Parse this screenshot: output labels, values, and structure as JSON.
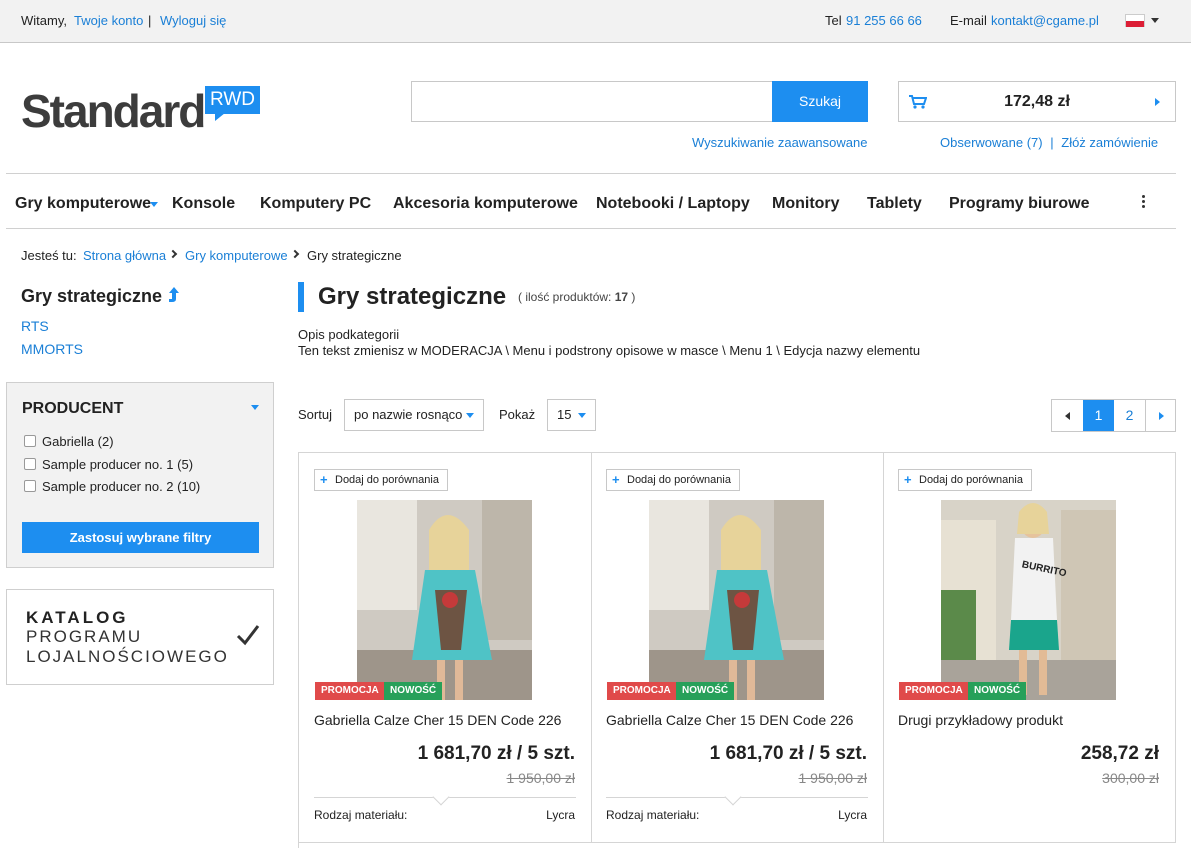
{
  "topbar": {
    "welcome": "Witamy,",
    "account_link": "Twoje konto",
    "separator": "|",
    "logout_link": "Wyloguj się",
    "phone_label": "Tel",
    "phone": "91 255 66 66",
    "email_label": "E-mail",
    "email": "kontakt@cgame.pl"
  },
  "header": {
    "logo": "Standard",
    "logo_badge": "RWD",
    "search_placeholder": "",
    "search_button": "Szukaj",
    "advanced_search": "Wyszukiwanie zaawansowane",
    "cart_total": "172,48 zł",
    "watched": "Obserwowane (7)",
    "separator": "|",
    "place_order": "Złóż zamówienie"
  },
  "nav": {
    "items": [
      "Gry komputerowe",
      "Konsole",
      "Komputery PC",
      "Akcesoria komputerowe",
      "Notebooki / Laptopy",
      "Monitory",
      "Tablety",
      "Programy biurowe"
    ]
  },
  "breadcrumb": {
    "label": "Jesteś tu:",
    "items": [
      "Strona główna",
      "Gry komputerowe",
      "Gry strategiczne"
    ]
  },
  "sidebar": {
    "title": "Gry strategiczne",
    "links": [
      "RTS",
      "MMORTS"
    ],
    "filter": {
      "title": "PRODUCENT",
      "options": [
        "Gabriella (2)",
        "Sample producer no. 1 (5)",
        "Sample producer no. 2 (10)"
      ],
      "apply": "Zastosuj wybrane filtry"
    },
    "loyalty": {
      "line1": "KATALOG",
      "line2": "PROGRAMU",
      "line3": "LOJALNOŚCIOWEGO"
    }
  },
  "main": {
    "title": "Gry strategiczne",
    "count_prefix": "( ilość produktów:",
    "count": "17",
    "count_suffix": ")",
    "desc_title": "Opis podkategorii",
    "desc_text": "Ten tekst zmienisz w MODERACJA \\ Menu i podstrony opisowe w masce \\ Menu 1 \\ Edycja nazwy elementu",
    "sort_label": "Sortuj",
    "sort_value": "po nazwie rosnąco",
    "show_label": "Pokaż",
    "show_value": "15",
    "pages": [
      "1",
      "2"
    ],
    "current_page": "1"
  },
  "products": [
    {
      "compare": "Dodaj do porównania",
      "badges": [
        "PROMOCJA",
        "NOWOŚĆ"
      ],
      "name": "Gabriella Calze Cher 15 DEN Code 226",
      "price": "1 681,70 zł / 5 szt.",
      "old_price": "1 950,00 zł",
      "attr_label": "Rodzaj materiału:",
      "attr_value": "Lycra"
    },
    {
      "compare": "Dodaj do porównania",
      "badges": [
        "PROMOCJA",
        "NOWOŚĆ"
      ],
      "name": "Gabriella Calze Cher 15 DEN Code 226",
      "price": "1 681,70 zł / 5 szt.",
      "old_price": "1 950,00 zł",
      "attr_label": "Rodzaj materiału:",
      "attr_value": "Lycra"
    },
    {
      "compare": "Dodaj do porównania",
      "badges": [
        "PROMOCJA",
        "NOWOŚĆ"
      ],
      "name": "Drugi przykładowy produkt",
      "price": "258,72 zł",
      "old_price": "300,00 zł"
    }
  ],
  "colors": {
    "accent": "#1d8ef0",
    "promo": "#e04a4a",
    "new": "#27a05a"
  }
}
